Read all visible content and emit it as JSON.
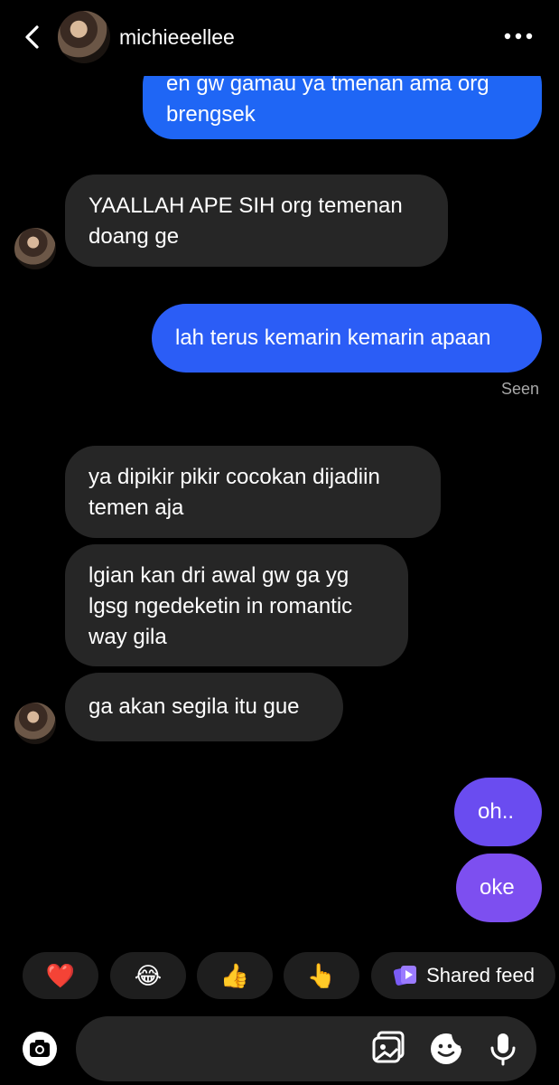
{
  "header": {
    "username": "michieeellee"
  },
  "messages": [
    {
      "from": "me",
      "lines": [
        "en gw gamau ya tmenan ama org",
        "brengsek"
      ]
    },
    {
      "from": "them",
      "lines": [
        "YAALLAH APE SIH org temenan",
        "doang ge"
      ]
    },
    {
      "from": "me",
      "lines": [
        "lah terus kemarin kemarin apaan"
      ]
    },
    {
      "from": "them",
      "lines": [
        "ya dipikir pikir cocokan dijadiin",
        "temen aja"
      ]
    },
    {
      "from": "them",
      "lines": [
        "lgian kan dri awal gw ga yg",
        "lgsg ngedeketin in romantic",
        "way gila"
      ]
    },
    {
      "from": "them",
      "lines": [
        "ga akan segila itu gue"
      ]
    },
    {
      "from": "me",
      "lines": [
        "oh.."
      ]
    },
    {
      "from": "me",
      "lines": [
        "oke"
      ]
    }
  ],
  "status": {
    "seen": "Seen"
  },
  "reactions": [
    {
      "emoji": "❤️",
      "icon": "heart-icon"
    },
    {
      "emoji": "😂",
      "icon": "laughing-icon"
    },
    {
      "emoji": "👍",
      "icon": "thumbs-up-icon"
    },
    {
      "emoji": "👆",
      "icon": "pointing-hand-icon"
    },
    {
      "label": "Shared feed",
      "icon": "shared-feed-icon"
    }
  ],
  "colors": {
    "outgoing_blue": "#1f66f5",
    "outgoing_purple": "#7750ee",
    "incoming": "#262626",
    "background": "#000000"
  }
}
